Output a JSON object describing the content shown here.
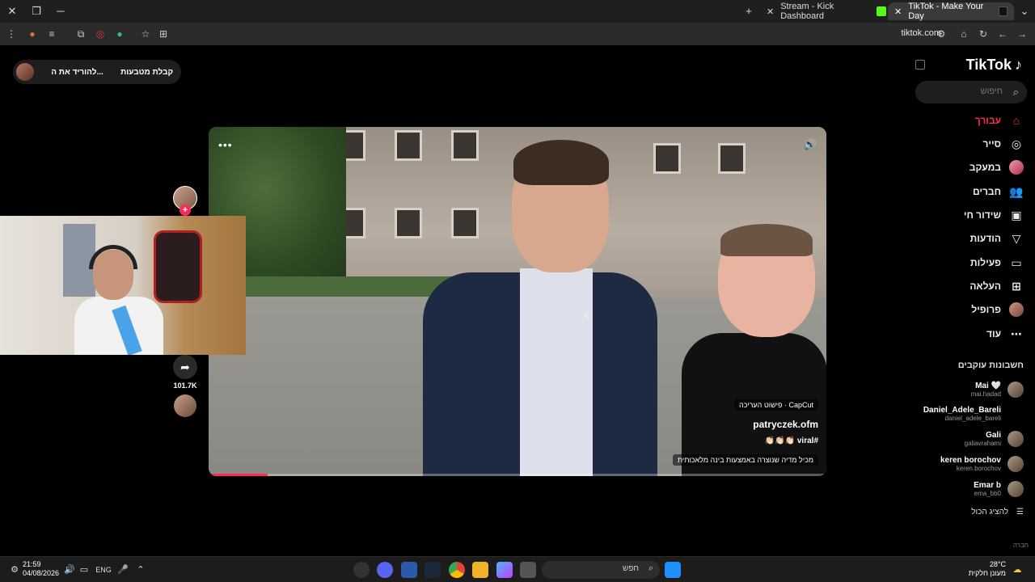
{
  "browser": {
    "tabs": [
      {
        "label": "Stream - Kick Dashboard"
      },
      {
        "label": "TikTok - Make Your Day"
      }
    ],
    "url": "tiktok.com"
  },
  "tiktok": {
    "logo": "TikTok",
    "search_placeholder": "חיפוש",
    "nav": [
      {
        "label": "עבורך",
        "icon": "home-icon"
      },
      {
        "label": "סייר",
        "icon": "compass-icon"
      },
      {
        "label": "במעקב",
        "icon": "following-avatar"
      },
      {
        "label": "חברים",
        "icon": "friends-icon"
      },
      {
        "label": "שידור חי",
        "icon": "live-icon"
      },
      {
        "label": "הודעות",
        "icon": "messages-icon"
      },
      {
        "label": "פעילות",
        "icon": "activity-icon"
      },
      {
        "label": "העלאה",
        "icon": "upload-icon"
      },
      {
        "label": "פרופיל",
        "icon": "profile-avatar"
      },
      {
        "label": "עוד",
        "icon": "more-icon"
      }
    ],
    "following_title": "חשבונות עוקבים",
    "following": [
      {
        "display": "Mai 🤍",
        "user": "mai.hadad"
      },
      {
        "display": "Daniel_Adele_Bareli",
        "user": "daniel_adele_bareli"
      },
      {
        "display": "Gali",
        "user": "galiavrahami"
      },
      {
        "display": "keren borochov",
        "user": "keren.borochov"
      },
      {
        "display": "Emar b",
        "user": "ema_bb0"
      }
    ],
    "show_all": "להציג הכול",
    "footer": "חברה",
    "pill": {
      "coins": "קבלת מטבעות",
      "download": "להוריד את ה..."
    },
    "video": {
      "capcut": "CapCut · פישוט העריכה",
      "author": "patryczek.ofm",
      "caption": "#viral 👏🏻👏🏻👏🏻",
      "ai_label": "מכיל מדיה שנוצרה באמצעות בינה מלאכותית",
      "progress": 0.095
    },
    "share_count": "101.7K"
  },
  "taskbar": {
    "time": "21:59",
    "date": "04/08/2026",
    "lang": "ENG",
    "search_label": "חפש",
    "weather_temp": "28°C",
    "weather_desc": "מעונן חלקית"
  }
}
